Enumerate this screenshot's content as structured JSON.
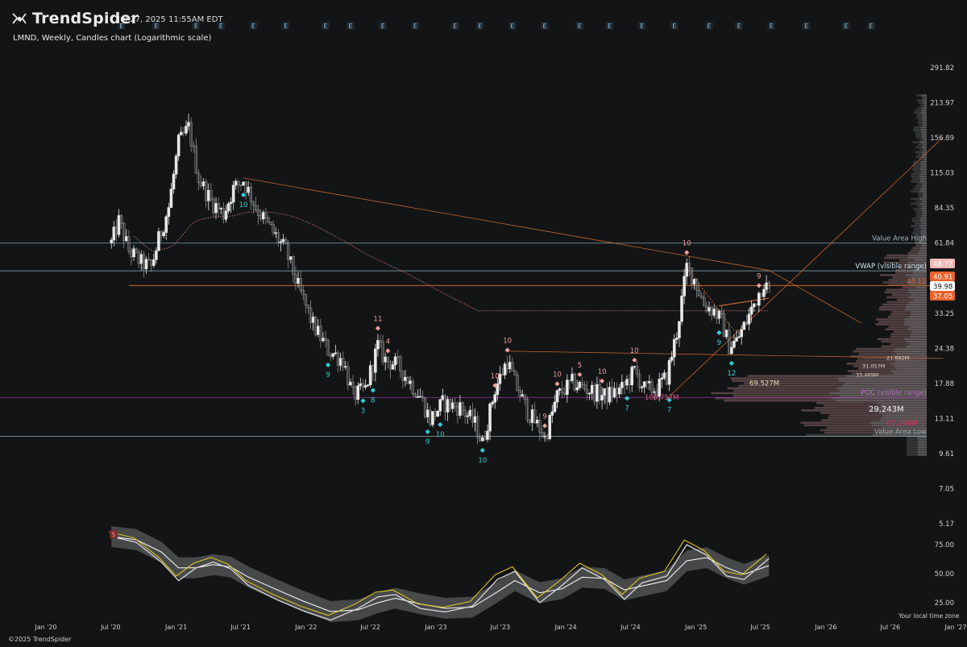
{
  "header": {
    "brand": "TrendSpider",
    "datetime": "Jul 27, 2025 11:55AM EDT",
    "subtitle": "LMND, Weekly, Candles chart (Logarithmic scale)",
    "event_marker": "E"
  },
  "footer": {
    "copyright": "©2025 TrendSpider",
    "timezone": "Your local time zone"
  },
  "colors": {
    "background": "#131416",
    "candle_up": "#e8e8e8",
    "candle_down": "#8c8c8c",
    "trendline": "#c8642a",
    "vwap_dots": "#d8827a",
    "signal_buy": "#2fd0d8",
    "signal_sell": "#f0a0a0",
    "poc_line": "#b040c0",
    "value_area_line": "#8fc6d2",
    "current_price": "#ffffff"
  },
  "chart_data": [
    {
      "type": "candlestick",
      "symbol": "LMND",
      "interval": "Weekly",
      "scale": "log",
      "ylim": [
        4.9,
        300
      ],
      "y_ticks": [
        "291.82",
        "213.97",
        "156.89",
        "115.03",
        "84.35",
        "61.84",
        "33.25",
        "24.38",
        "17.88",
        "13.11",
        "9.61",
        "7.05",
        "5.17"
      ],
      "x_ticks": [
        "Jan '20",
        "Jul '20",
        "Jan '21",
        "Jul '21",
        "Jan '22",
        "Jul '22",
        "Jan '23",
        "Jul '23",
        "Jan '24",
        "Jul '24",
        "Jan '25",
        "Jul '25",
        "Jan '26",
        "Jul '26",
        "Jan '27"
      ],
      "price_path": [
        [
          "2020-07-03",
          62
        ],
        [
          "2020-07-24",
          75
        ],
        [
          "2020-08-21",
          58
        ],
        [
          "2020-09-25",
          52
        ],
        [
          "2020-10-23",
          50
        ],
        [
          "2020-11-13",
          64
        ],
        [
          "2020-12-11",
          85
        ],
        [
          "2021-01-08",
          150
        ],
        [
          "2021-01-22",
          160
        ],
        [
          "2021-02-05",
          172
        ],
        [
          "2021-03-05",
          110
        ],
        [
          "2021-04-09",
          90
        ],
        [
          "2021-05-14",
          80
        ],
        [
          "2021-06-11",
          100
        ],
        [
          "2021-07-09",
          108
        ],
        [
          "2021-08-13",
          85
        ],
        [
          "2021-09-24",
          70
        ],
        [
          "2021-11-05",
          58
        ],
        [
          "2021-12-10",
          42
        ],
        [
          "2022-01-21",
          30
        ],
        [
          "2022-03-04",
          24
        ],
        [
          "2022-04-15",
          22
        ],
        [
          "2022-05-13",
          16
        ],
        [
          "2022-06-17",
          17
        ],
        [
          "2022-07-22",
          25
        ],
        [
          "2022-08-12",
          22
        ],
        [
          "2022-09-16",
          21
        ],
        [
          "2022-10-21",
          18
        ],
        [
          "2022-11-18",
          16
        ],
        [
          "2022-12-16",
          13
        ],
        [
          "2023-01-20",
          15
        ],
        [
          "2023-03-10",
          14.5
        ],
        [
          "2023-04-21",
          12.5
        ],
        [
          "2023-05-12",
          10.5
        ],
        [
          "2023-06-16",
          17
        ],
        [
          "2023-07-21",
          22
        ],
        [
          "2023-08-11",
          18
        ],
        [
          "2023-09-15",
          14
        ],
        [
          "2023-10-20",
          12
        ],
        [
          "2023-11-03",
          11
        ],
        [
          "2023-12-08",
          16
        ],
        [
          "2024-01-19",
          18
        ],
        [
          "2024-03-01",
          17
        ],
        [
          "2024-04-19",
          16
        ],
        [
          "2024-06-07",
          17
        ],
        [
          "2024-07-12",
          20
        ],
        [
          "2024-08-09",
          17
        ],
        [
          "2024-09-13",
          17
        ],
        [
          "2024-10-11",
          19
        ],
        [
          "2024-11-08",
          28
        ],
        [
          "2024-12-06",
          50
        ],
        [
          "2024-12-27",
          45
        ],
        [
          "2025-01-24",
          36
        ],
        [
          "2025-02-21",
          34
        ],
        [
          "2025-03-14",
          31
        ],
        [
          "2025-04-04",
          25
        ],
        [
          "2025-04-25",
          26
        ],
        [
          "2025-05-23",
          31
        ],
        [
          "2025-06-20",
          38
        ],
        [
          "2025-07-11",
          44
        ],
        [
          "2025-07-25",
          40
        ]
      ],
      "last_price": 39.98,
      "price_tags": [
        {
          "label": "48.77",
          "value": 48.77,
          "color": "#f2b8b8"
        },
        {
          "label": "40.91",
          "value": 40.91,
          "color": "#e9622a"
        },
        {
          "label": "39.98",
          "value": 39.98,
          "color": "#ffffff"
        },
        {
          "label": "37.05",
          "value": 37.05,
          "color": "#e9622a"
        }
      ],
      "levels": [
        {
          "label": "Value Area High",
          "value": 61.84
        },
        {
          "label": "VWAP (visible range)",
          "value": 48.4
        },
        {
          "label": "POC (visible range)",
          "value": 15.8
        },
        {
          "label": "Value Area Low",
          "value": 11.2
        }
      ],
      "sequential_counts": [
        {
          "date": "2021-07-09",
          "label": "10",
          "side": "buy"
        },
        {
          "date": "2022-03-04",
          "label": "9",
          "side": "buy"
        },
        {
          "date": "2022-06-10",
          "label": "3",
          "side": "buy"
        },
        {
          "date": "2022-07-08",
          "label": "8",
          "side": "buy"
        },
        {
          "date": "2022-07-22",
          "label": "11",
          "side": "sell"
        },
        {
          "date": "2022-08-19",
          "label": "4",
          "side": "sell"
        },
        {
          "date": "2022-12-09",
          "label": "9",
          "side": "buy"
        },
        {
          "date": "2023-01-13",
          "label": "10",
          "side": "buy"
        },
        {
          "date": "2023-05-12",
          "label": "10",
          "side": "buy"
        },
        {
          "date": "2023-06-16",
          "label": "10",
          "side": "sell"
        },
        {
          "date": "2023-07-21",
          "label": "10",
          "side": "sell"
        },
        {
          "date": "2023-11-03",
          "label": "9",
          "side": "sell"
        },
        {
          "date": "2023-12-08",
          "label": "10",
          "side": "sell"
        },
        {
          "date": "2024-02-09",
          "label": "5",
          "side": "sell"
        },
        {
          "date": "2024-04-12",
          "label": "10",
          "side": "sell"
        },
        {
          "date": "2024-06-21",
          "label": "7",
          "side": "buy"
        },
        {
          "date": "2024-07-12",
          "label": "10",
          "side": "sell"
        },
        {
          "date": "2024-10-18",
          "label": "7",
          "side": "buy"
        },
        {
          "date": "2024-12-06",
          "label": "10",
          "side": "sell"
        },
        {
          "date": "2025-03-07",
          "label": "9",
          "side": "buy"
        },
        {
          "date": "2025-04-11",
          "label": "12",
          "side": "buy"
        },
        {
          "date": "2025-06-27",
          "label": "9",
          "side": "sell"
        }
      ],
      "volume_profile_labels": [
        {
          "label": "21.692M",
          "value": 22.5
        },
        {
          "label": "31.057M",
          "value": 21.0
        },
        {
          "label": "33.469M",
          "value": 19.4
        },
        {
          "label": "69.527M",
          "value": 17.9
        },
        {
          "label": "105.757M",
          "value": 15.8
        },
        {
          "label": "29.243M",
          "value": 14.2
        },
        {
          "label": "67.296M",
          "value": 12.6
        },
        {
          "label": "44.12",
          "value": 44.12
        }
      ]
    },
    {
      "type": "line",
      "panel": "oscillator",
      "ylim": [
        0,
        100
      ],
      "y_ticks": [
        "75.00",
        "50.00",
        "25.00"
      ],
      "series": [
        {
          "values": [
            [
              "2020-07-03",
              82
            ],
            [
              "2020-09-11",
              77
            ],
            [
              "2020-11-20",
              60
            ],
            [
              "2021-01-08",
              44
            ],
            [
              "2021-02-26",
              55
            ],
            [
              "2021-04-16",
              60
            ],
            [
              "2021-06-04",
              54
            ],
            [
              "2021-07-23",
              40
            ],
            [
              "2021-10-08",
              28
            ],
            [
              "2021-12-24",
              18
            ],
            [
              "2022-03-11",
              10
            ],
            [
              "2022-05-27",
              20
            ],
            [
              "2022-07-22",
              30
            ],
            [
              "2022-09-09",
              32
            ],
            [
              "2022-11-18",
              20
            ],
            [
              "2023-01-27",
              17
            ],
            [
              "2023-04-14",
              22
            ],
            [
              "2023-06-23",
              45
            ],
            [
              "2023-08-11",
              52
            ],
            [
              "2023-10-20",
              25
            ],
            [
              "2023-12-22",
              40
            ],
            [
              "2024-02-16",
              55
            ],
            [
              "2024-04-19",
              45
            ],
            [
              "2024-06-14",
              28
            ],
            [
              "2024-08-02",
              42
            ],
            [
              "2024-10-11",
              48
            ],
            [
              "2024-12-06",
              75
            ],
            [
              "2025-01-31",
              66
            ],
            [
              "2025-03-28",
              48
            ],
            [
              "2025-05-16",
              45
            ],
            [
              "2025-07-25",
              63
            ]
          ]
        }
      ]
    }
  ]
}
